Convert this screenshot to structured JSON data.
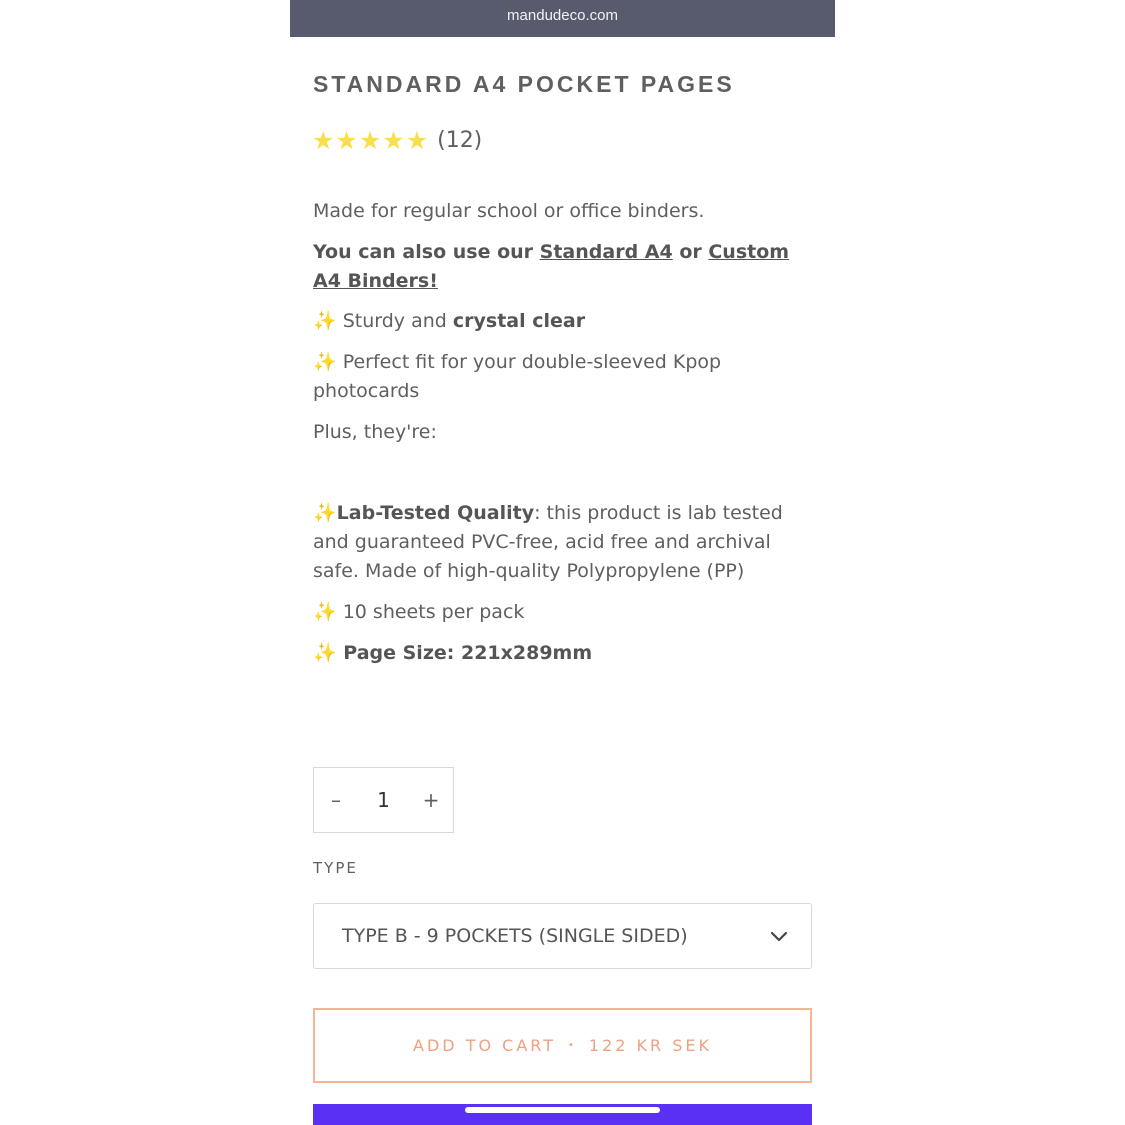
{
  "browser": {
    "url": "mandudeco.com"
  },
  "product": {
    "title": "STANDARD A4 POCKET PAGES",
    "rating": {
      "stars": 5,
      "count": "(12)",
      "star_color": "#f9df4a"
    },
    "desc": {
      "line1": "Made for regular school or office binders.",
      "also_prefix": "You can also use our ",
      "link1": "Standard A4",
      "or": " or ",
      "link2": "Custom A4 Binders!",
      "sparkle": "✨",
      "sturdy_prefix": " Sturdy and ",
      "sturdy_bold": "crystal clear",
      "fit": " Perfect fit for your double-sleeved Kpop photocards",
      "plus": "Plus, they're:",
      "lab_bold": "Lab-Tested Quality",
      "lab_rest": ": this product is lab tested and guaranteed PVC-free, acid free and archival safe. Made of high-quality Polypropylene (PP)",
      "sheets": " 10 sheets per pack",
      "size": " Page Size: 221x289mm"
    }
  },
  "quantity": {
    "minus": "–",
    "value": "1",
    "plus": "+"
  },
  "variant": {
    "label": "TYPE",
    "selected": "TYPE B - 9 POCKETS (SINGLE SIDED)"
  },
  "cart": {
    "label": "ADD TO CART",
    "separator": "•",
    "price": "122 KR SEK",
    "accent": "#f0a07e"
  },
  "colors": {
    "urlbar": "#575b6d",
    "pay_button": "#5a31f4"
  }
}
